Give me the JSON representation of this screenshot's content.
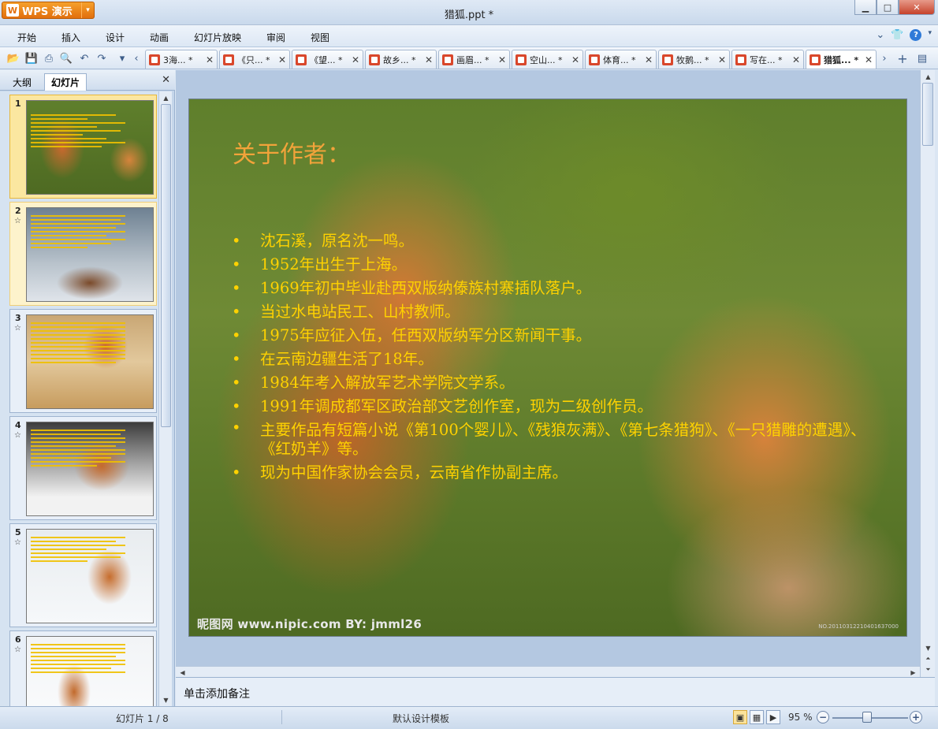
{
  "app": {
    "name": "WPS 演示",
    "window_title": "猎狐.ppt *"
  },
  "menu": [
    "开始",
    "插入",
    "设计",
    "动画",
    "幻灯片放映",
    "审阅",
    "视图"
  ],
  "tabs": [
    {
      "label": "3海... *"
    },
    {
      "label": "《只... *"
    },
    {
      "label": "《望... *"
    },
    {
      "label": "故乡... *"
    },
    {
      "label": "画眉... *"
    },
    {
      "label": "空山... *"
    },
    {
      "label": "体育... *"
    },
    {
      "label": "牧鹅... *"
    },
    {
      "label": "写在... *"
    },
    {
      "label": "猎狐... *",
      "active": true
    }
  ],
  "left_panel": {
    "tab_outline": "大纲",
    "tab_slides": "幻灯片",
    "thumbnails": [
      {
        "num": "1",
        "theme": "fox-pair",
        "selected": true
      },
      {
        "num": "2",
        "theme": "fox-snow-road"
      },
      {
        "num": "3",
        "theme": "fox-grass"
      },
      {
        "num": "4",
        "theme": "fox-snow-close"
      },
      {
        "num": "5",
        "theme": "fox-snow-sit"
      },
      {
        "num": "6",
        "theme": "fox-light"
      }
    ]
  },
  "slide": {
    "title": "关于作者：",
    "bullets": [
      "沈石溪，原名沈一鸣。",
      "1952年出生于上海。",
      "1969年初中毕业赴西双版纳傣族村寨插队落户。",
      "当过水电站民工、山村教师。",
      "1975年应征入伍，任西双版纳军分区新闻干事。",
      "在云南边疆生活了18年。",
      "1984年考入解放军艺术学院文学系。",
      "1991年调成都军区政治部文艺创作室，现为二级创作员。",
      "主要作品有短篇小说《第100个婴儿》、《残狼灰满》、《第七条猎狗》、《一只猎雕的遭遇》、《红奶羊》等。",
      "现为中国作家协会会员，云南省作协副主席。"
    ],
    "watermark": "昵图网 www.nipic.com   BY: jmml26",
    "watermark_id": "NO.20110312210401637000"
  },
  "notes_placeholder": "单击添加备注",
  "status": {
    "slide_counter": "幻灯片 1 / 8",
    "template": "默认设计模板",
    "zoom": "95 %"
  },
  "colors": {
    "title": "#f2a33a",
    "bullet": "#ffd200",
    "app_button": "#e26f0c"
  }
}
